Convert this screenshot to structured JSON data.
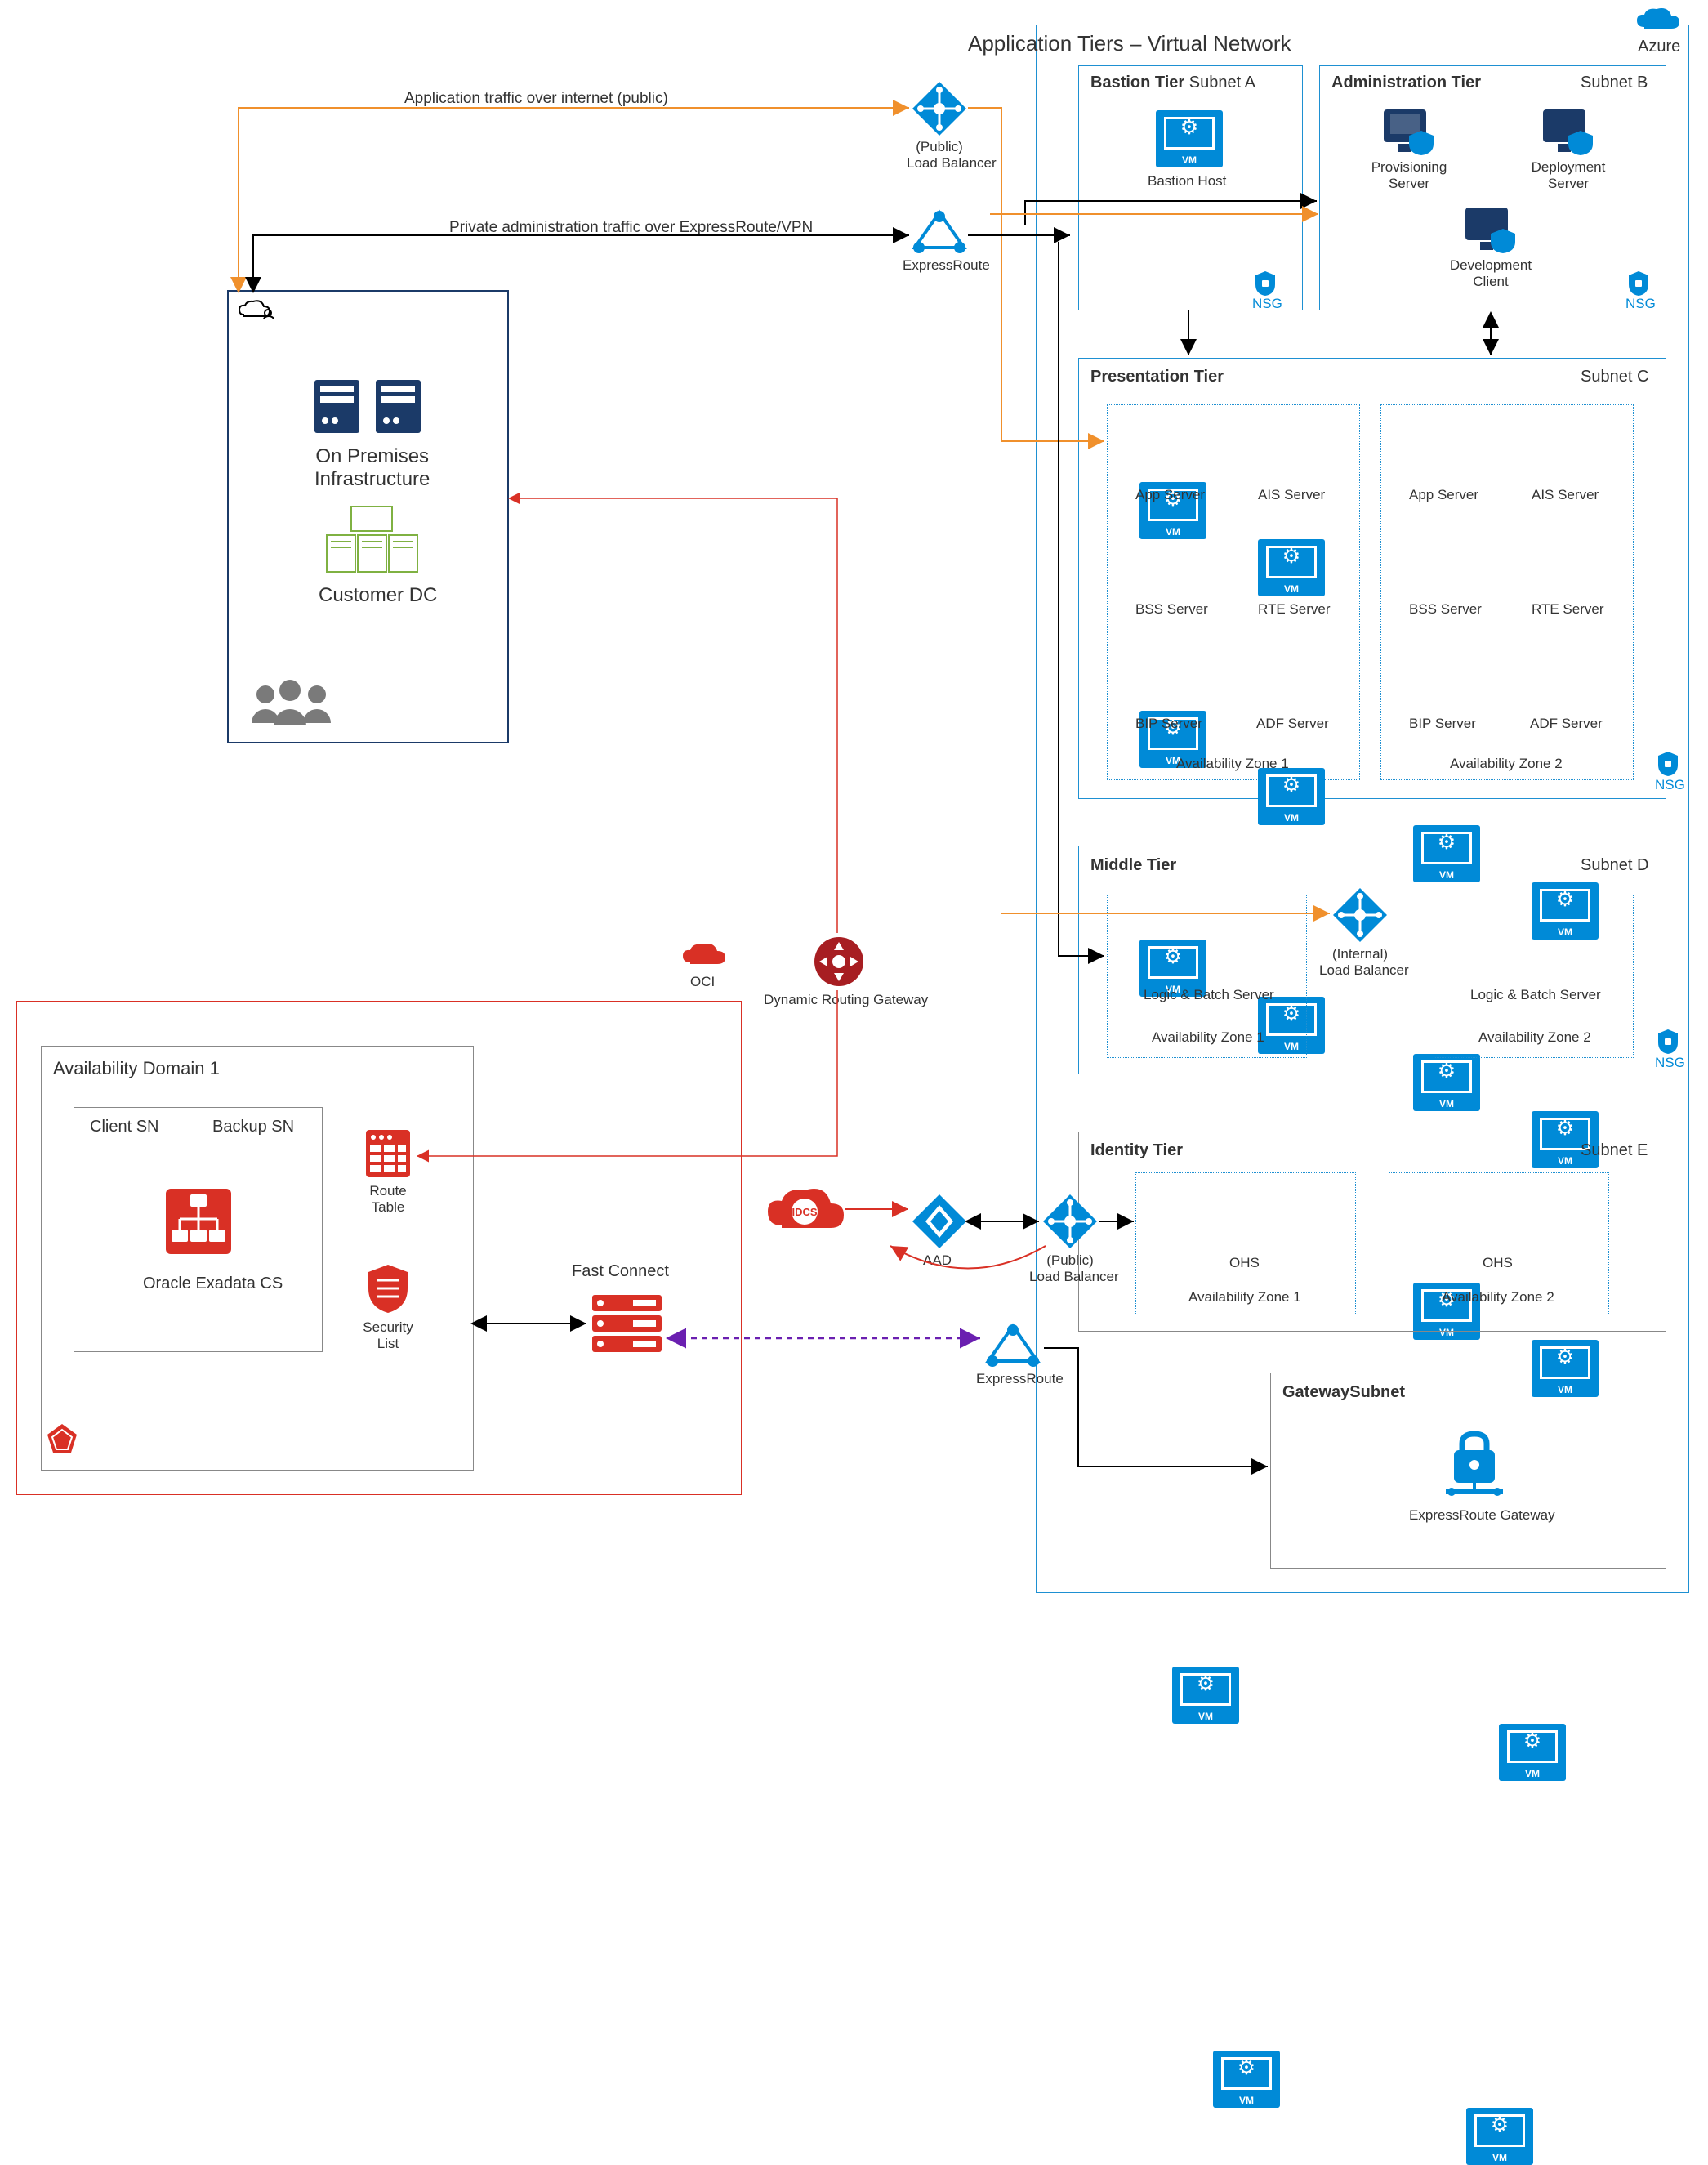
{
  "cloud": {
    "azure": "Azure",
    "oci": "OCI"
  },
  "vnet": {
    "title": "Application Tiers – Virtual Network"
  },
  "traffic": {
    "public": "Application traffic over internet (public)",
    "private": "Private administration traffic over ExpressRoute/VPN"
  },
  "gw": {
    "public_lb": "(Public)\nLoad Balancer",
    "expressroute": "ExpressRoute",
    "expressroute2": "ExpressRoute",
    "drg": "Dynamic Routing Gateway",
    "internal_lb": "(Internal)\nLoad Balancer",
    "public_lb2": "(Public)\nLoad Balancer",
    "aad": "AAD",
    "idcs": "IDCS",
    "fastconnect": "Fast Connect"
  },
  "onprem": {
    "infra": "On Premises\nInfrastructure",
    "dc": "Customer DC"
  },
  "tiers": {
    "bastion": {
      "title": "Bastion Tier",
      "subnet": "Subnet A",
      "host": "Bastion Host",
      "nsg": "NSG"
    },
    "admin": {
      "title": "Administration Tier",
      "subnet": "Subnet B",
      "prov": "Provisioning\nServer",
      "dep": "Deployment\nServer",
      "dev": "Development\nClient",
      "nsg": "NSG"
    },
    "pres": {
      "title": "Presentation Tier",
      "subnet": "Subnet C",
      "az1": "Availability Zone 1",
      "az2": "Availability Zone 2",
      "app": "App Server",
      "ais": "AIS Server",
      "bss": "BSS Server",
      "rte": "RTE Server",
      "bip": "BIP Server",
      "adf": "ADF Server",
      "nsg": "NSG"
    },
    "mid": {
      "title": "Middle Tier",
      "subnet": "Subnet D",
      "lb1": "Logic & Batch Server",
      "lb2": "Logic & Batch Server",
      "az1": "Availability Zone 1",
      "az2": "Availability Zone 2",
      "nsg": "NSG"
    },
    "id": {
      "title": "Identity Tier",
      "subnet": "Subnet E",
      "ohs1": "OHS",
      "ohs2": "OHS",
      "az1": "Availability Zone 1",
      "az2": "Availability Zone 2"
    },
    "gwsub": {
      "title": "GatewaySubnet",
      "erg": "ExpressRoute Gateway"
    }
  },
  "oci_region": {
    "ad1": "Availability Domain 1",
    "client_sn": "Client SN",
    "backup_sn": "Backup SN",
    "exadata": "Oracle Exadata CS",
    "rt": "Route\nTable",
    "sl": "Security\nList"
  },
  "vm_label": "VM"
}
